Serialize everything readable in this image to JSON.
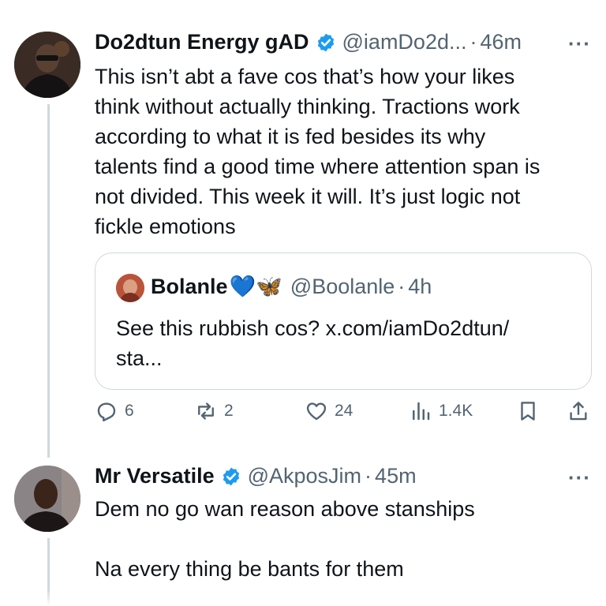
{
  "tweet1": {
    "name": "Do2dtun Energy gAD",
    "handle": "@iamDo2d...",
    "separator": "·",
    "time": "46m",
    "more": "···",
    "text_lines": [
      "This isn’t abt a fave cos that’s how your likes",
      "think without actually thinking. Tractions work",
      "according to what it is fed besides its why",
      "talents find a good time where attention span is",
      "not divided. This week it will. It’s just logic not",
      "fickle emotions"
    ],
    "quote": {
      "name": "Bolanle",
      "emojis": "💙🦋",
      "handle": "@Boolanle",
      "separator": "·",
      "time": "4h",
      "text_lines": [
        "See this rubbish cos? x.com/iamDo2dtun/",
        "sta..."
      ]
    },
    "actions": {
      "replies": "6",
      "reposts": "2",
      "likes": "24",
      "views": "1.4K"
    }
  },
  "tweet2": {
    "name": "Mr Versatile",
    "handle": "@AkposJim",
    "separator": "·",
    "time": "45m",
    "more": "···",
    "text_lines": [
      "Dem no go wan reason above stanships",
      "",
      "Na every thing be bants for them"
    ]
  },
  "colors": {
    "verified": "#1d9bf0",
    "secondary": "#536471",
    "border": "#cfd9de"
  }
}
